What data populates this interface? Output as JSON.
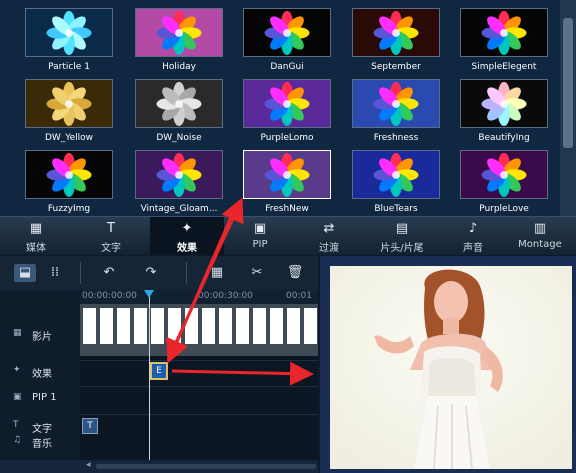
{
  "effects_gallery": {
    "items": [
      {
        "label": "Particle 1",
        "bg": "#0a2a4a",
        "petal": "cyan"
      },
      {
        "label": "Holiday",
        "bg": "#b24aa6",
        "petal": "rainbow"
      },
      {
        "label": "DanGui",
        "bg": "#050505",
        "petal": "rainbow"
      },
      {
        "label": "September",
        "bg": "#2a0a06",
        "petal": "rainbow"
      },
      {
        "label": "SimpleElegent",
        "bg": "#050505",
        "petal": "rainbow"
      },
      {
        "label": "DW_Yellow",
        "bg": "#3a2a08",
        "petal": "gold"
      },
      {
        "label": "DW_Noise",
        "bg": "#2a2a2a",
        "petal": "gray"
      },
      {
        "label": "PurpleLomo",
        "bg": "#5a2a9a",
        "petal": "rainbow"
      },
      {
        "label": "Freshness",
        "bg": "#2a4ab2",
        "petal": "rainbow"
      },
      {
        "label": "BeautifyIng",
        "bg": "#0a0a0a",
        "petal": "pastel"
      },
      {
        "label": "FuzzyImg",
        "bg": "#050505",
        "petal": "rainbow"
      },
      {
        "label": "Vintage_Gloam...",
        "bg": "#3a1a5a",
        "petal": "rainbow"
      },
      {
        "label": "FreshNew",
        "bg": "#5a3a8a",
        "petal": "rainbow"
      },
      {
        "label": "BlueTears",
        "bg": "#1a2a9a",
        "petal": "rainbow"
      },
      {
        "label": "PurpleLove",
        "bg": "#3a0a4a",
        "petal": "rainbow"
      }
    ]
  },
  "tabs": [
    {
      "label": "媒体",
      "icon": "film-icon"
    },
    {
      "label": "文字",
      "icon": "text-icon"
    },
    {
      "label": "效果",
      "icon": "magic-wand-icon",
      "active": true
    },
    {
      "label": "PIP",
      "icon": "pip-icon"
    },
    {
      "label": "过渡",
      "icon": "transition-icon"
    },
    {
      "label": "片头/片尾",
      "icon": "credits-icon"
    },
    {
      "label": "声音",
      "icon": "headphones-icon"
    },
    {
      "label": "Montage",
      "icon": "montage-icon"
    }
  ],
  "toolbar": {
    "icons": [
      "storyboard-icon",
      "timeline-view-icon",
      "undo-icon",
      "redo-icon",
      "film-split-icon",
      "scissors-icon",
      "delete-icon"
    ]
  },
  "ruler": {
    "marks": [
      "00:00:00:00",
      "00:00:30:00",
      "00:01"
    ]
  },
  "tracks": [
    {
      "name": "影片",
      "icon": "video-track-icon"
    },
    {
      "name": "效果",
      "icon": "effect-track-icon"
    },
    {
      "name": "PIP 1",
      "icon": "pip-track-icon"
    },
    {
      "name": "文字",
      "icon": "text-track-icon",
      "glyph": "T"
    },
    {
      "name": "音乐",
      "icon": "music-track-icon",
      "glyph": "♫"
    }
  ],
  "clips": {
    "effect_badge": "E",
    "text_badge": "T"
  },
  "preview": {
    "description_alt": "preview-photo"
  },
  "colors": {
    "accent": "#29a7e6",
    "arrow": "#e8262b",
    "tab_active": "#0a1420"
  }
}
